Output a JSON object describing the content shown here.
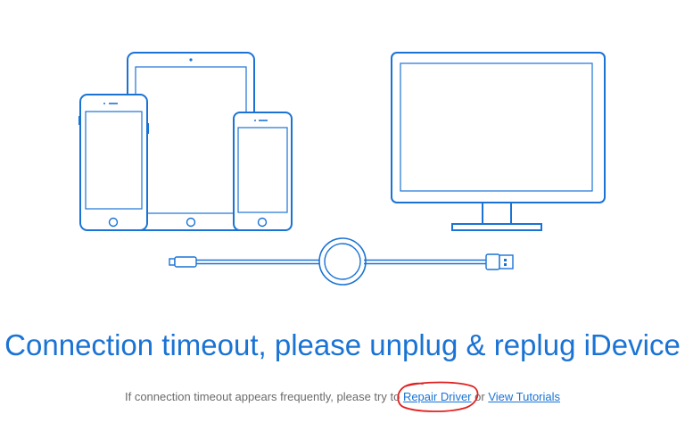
{
  "colors": {
    "accent": "#1a73d4",
    "muted_text": "#6b6b6b",
    "annotation": "#e02020",
    "background": "#ffffff"
  },
  "illustration": {
    "devices": [
      "iphone-icon",
      "ipad-icon",
      "iphone-small-icon",
      "monitor-icon"
    ],
    "cable": "usb-lightning-cable-icon"
  },
  "message": {
    "headline": "Connection timeout, please unplug & replug iDevice",
    "hint_prefix": "If connection timeout appears frequently, please try to",
    "repair_link": "Repair Driver",
    "or_text": "or",
    "tutorials_link": "View Tutorials"
  }
}
